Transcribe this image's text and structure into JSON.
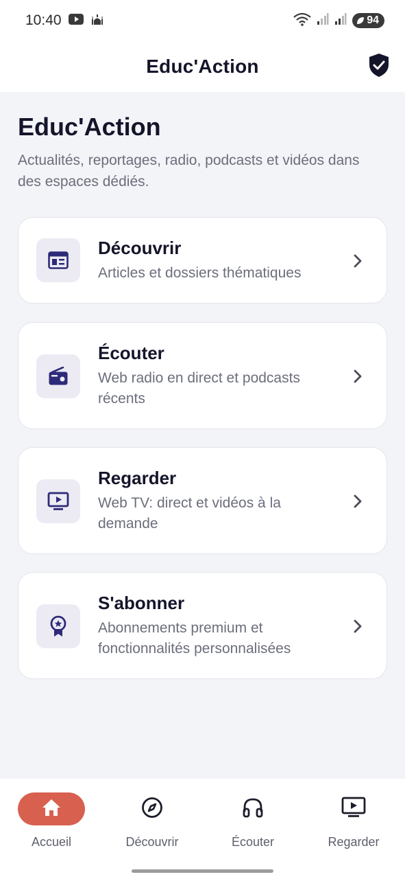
{
  "status_bar": {
    "time": "10:40",
    "battery": "94"
  },
  "app_bar": {
    "title": "Educ'Action"
  },
  "hero": {
    "title": "Educ'Action",
    "subtitle": "Actualités, reportages, radio, podcasts et vidéos dans des espaces dédiés."
  },
  "cards": [
    {
      "title": "Découvrir",
      "description": "Articles et dossiers thématiques",
      "icon": "newspaper-icon"
    },
    {
      "title": "Écouter",
      "description": "Web radio en direct et podcasts récents",
      "icon": "radio-icon"
    },
    {
      "title": "Regarder",
      "description": "Web TV: direct et vidéos à la demande",
      "icon": "tv-play-icon"
    },
    {
      "title": "S'abonner",
      "description": "Abonnements premium et fonctionnalités personnalisées",
      "icon": "award-badge-icon"
    }
  ],
  "bottom_nav": {
    "items": [
      {
        "label": "Accueil",
        "icon": "home-icon",
        "active": true
      },
      {
        "label": "Découvrir",
        "icon": "compass-icon",
        "active": false
      },
      {
        "label": "Écouter",
        "icon": "headphones-icon",
        "active": false
      },
      {
        "label": "Regarder",
        "icon": "tv-play-icon",
        "active": false
      }
    ]
  },
  "colors": {
    "accent": "#d8604f",
    "icon_primary": "#2e2a7a",
    "text_primary": "#14152a",
    "text_secondary": "#6b6e7b",
    "background": "#f3f4f8"
  }
}
